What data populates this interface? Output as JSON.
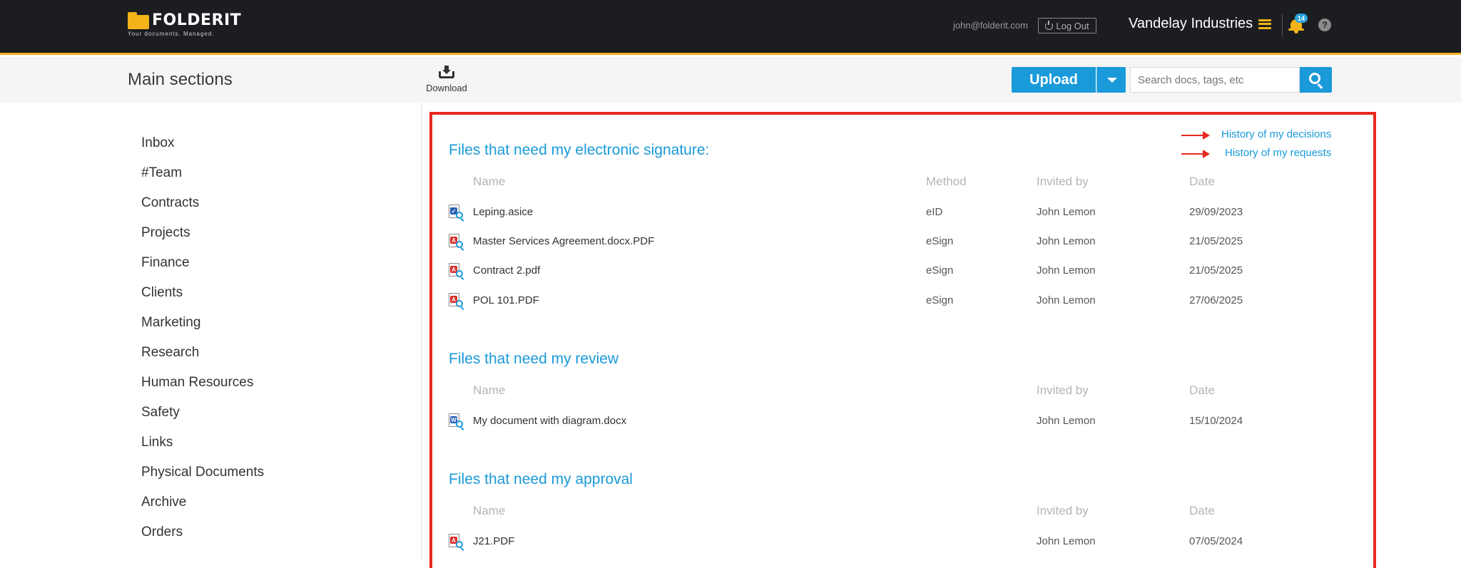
{
  "header": {
    "logo_text": "FOLDERIT",
    "logo_tagline": "Your documents. Managed.",
    "user_email": "john@folderit.com",
    "logout_label": "Log Out",
    "company_name": "Vandelay Industries",
    "notification_count": "14",
    "help_label": "?"
  },
  "toolbar": {
    "section_title": "Main sections",
    "download_label": "Download",
    "upload_label": "Upload",
    "search_placeholder": "Search docs, tags, etc"
  },
  "sidebar": {
    "items": [
      {
        "label": "Inbox"
      },
      {
        "label": "#Team"
      },
      {
        "label": "Contracts"
      },
      {
        "label": "Projects"
      },
      {
        "label": "Finance"
      },
      {
        "label": "Clients"
      },
      {
        "label": "Marketing"
      },
      {
        "label": "Research"
      },
      {
        "label": "Human Resources"
      },
      {
        "label": "Safety"
      },
      {
        "label": "Links"
      },
      {
        "label": "Physical Documents"
      },
      {
        "label": "Archive"
      },
      {
        "label": "Orders"
      }
    ]
  },
  "links": {
    "history_decisions": "History of my decisions",
    "history_requests": "History of my requests"
  },
  "signature": {
    "title": "Files that need my electronic signature:",
    "columns": {
      "name": "Name",
      "method": "Method",
      "invited_by": "Invited by",
      "date": "Date"
    },
    "rows": [
      {
        "name": "Leping.asice",
        "method": "eID",
        "invited_by": "John Lemon",
        "date": "29/09/2023",
        "icon": "asice-file-icon"
      },
      {
        "name": "Master Services Agreement.docx.PDF",
        "method": "eSign",
        "invited_by": "John Lemon",
        "date": "21/05/2025",
        "icon": "pdf-file-icon"
      },
      {
        "name": "Contract 2.pdf",
        "method": "eSign",
        "invited_by": "John Lemon",
        "date": "21/05/2025",
        "icon": "pdf-file-icon"
      },
      {
        "name": "POL 101.PDF",
        "method": "eSign",
        "invited_by": "John Lemon",
        "date": "27/06/2025",
        "icon": "pdf-file-icon"
      }
    ]
  },
  "review": {
    "title": "Files that need my review",
    "columns": {
      "name": "Name",
      "invited_by": "Invited by",
      "date": "Date"
    },
    "rows": [
      {
        "name": "My document with diagram.docx",
        "invited_by": "John Lemon",
        "date": "15/10/2024",
        "icon": "word-file-icon"
      }
    ]
  },
  "approval": {
    "title": "Files that need my approval",
    "columns": {
      "name": "Name",
      "invited_by": "Invited by",
      "date": "Date"
    },
    "rows": [
      {
        "name": "J21.PDF",
        "invited_by": "John Lemon",
        "date": "07/05/2024",
        "icon": "pdf-file-icon"
      }
    ]
  },
  "colors": {
    "accent": "#1a9ad9",
    "brand_yellow": "#f2b418",
    "highlight_red": "#e8281e",
    "topbar_bg": "#1b1d21"
  }
}
